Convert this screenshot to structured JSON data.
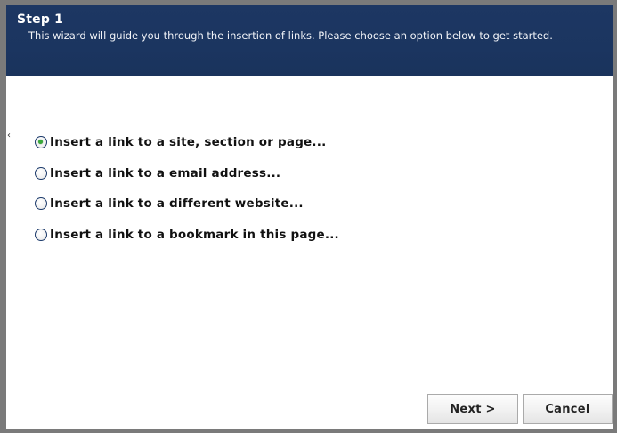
{
  "wizard": {
    "step_title": "Step 1",
    "description": "This wizard will guide you through the insertion of links. Please choose an option below to get started."
  },
  "options": [
    {
      "label": "Insert a link to a site, section or page...",
      "selected": true
    },
    {
      "label": "Insert a link to a email address...",
      "selected": false
    },
    {
      "label": "Insert a link to a different website...",
      "selected": false
    },
    {
      "label": "Insert a link to a bookmark in this page...",
      "selected": false
    }
  ],
  "buttons": {
    "next": "Next >",
    "cancel": "Cancel"
  },
  "colors": {
    "header_bg": "#1b3560",
    "radio_selected": "#3aa83a"
  }
}
